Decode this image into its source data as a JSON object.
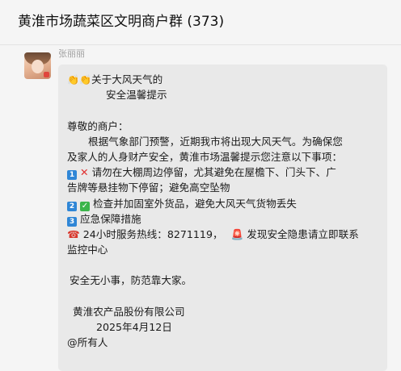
{
  "header": {
    "title": "黄淮市场蔬菜区文明商户群 (373)"
  },
  "message": {
    "sender": "张丽丽",
    "title_line1": "关于大风天气的",
    "title_line2": "安全温馨提示",
    "greeting": "尊敬的商户：",
    "intro_line1": "根据气象部门预警，近期我市将出现大风天气。为确保您",
    "intro_line2": "及家人的人身财产安全，黄淮市场温馨提示您注意以下事项：",
    "item1_num": "1",
    "item1_line1": "请勿在大棚周边停留，尤其避免在屋檐下、门头下、广",
    "item1_line2": "告牌等悬挂物下停留；避免高空坠物",
    "item2_num": "2",
    "item2_text": "检查并加固室外货品，避免大风天气货物丢失",
    "item3_num": "3",
    "item3_text": "应急保障措施",
    "hotline_text": "24小时服务热线：8271119，",
    "alert_line1": "发现安全隐患请立即联系",
    "alert_line2": "监控中心",
    "slogan": "安全无小事，防范靠大家。",
    "company": "黄淮农产品股份有限公司",
    "date": "2025年4月12日",
    "mention": "@所有人"
  },
  "icons": {
    "title_icon": "clapping-hands-emoji",
    "item1_icon": "red-cross-emoji",
    "item2_icon": "green-check-emoji",
    "phone_icon": "telephone-receiver-emoji",
    "alert_icon": "police-light-emoji"
  },
  "colors": {
    "bubble_bg": "#e9e9e9",
    "number_badge": "#2f86d6",
    "check_badge": "#3bb54a",
    "cross": "#e03030"
  }
}
